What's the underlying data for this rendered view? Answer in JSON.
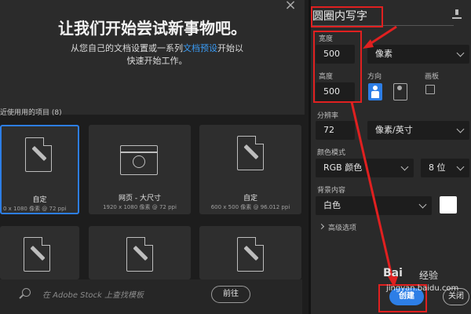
{
  "hero": {
    "title": "让我们开始尝试新事物吧。",
    "subtitle_pre": "从您自己的文档设置或一系列",
    "subtitle_link": "文档预设",
    "subtitle_post": "开始以",
    "subtitle_line2": "快速开始工作。"
  },
  "recent": {
    "label": "近使用用的项目 (8)",
    "cards": [
      {
        "name": "自定",
        "spec": "0 x 1080 像素 @ 72 ppi",
        "icon": "document-brush-icon"
      },
      {
        "name": "网页 - 大尺寸",
        "spec": "1920 x 1080 像素 @ 72 ppi",
        "icon": "browser-globe-icon"
      },
      {
        "name": "自定",
        "spec": "600 x 500 像素 @ 96.012 ppi",
        "icon": "document-brush-icon"
      }
    ]
  },
  "search": {
    "placeholder": "在 Adobe Stock 上查找模板",
    "button": "前往"
  },
  "preset": {
    "name": "圆圈内写字",
    "width_label": "宽度",
    "width": "500",
    "width_unit": "像素",
    "height_label": "高度",
    "height": "500",
    "orientation_label": "方向",
    "artboard_label": "画板",
    "resolution_label": "分辨率",
    "resolution": "72",
    "resolution_unit": "像素/英寸",
    "color_mode_label": "颜色模式",
    "color_mode": "RGB 颜色",
    "bit_depth": "8 位",
    "background_label": "背景内容",
    "background": "白色",
    "background_swatch": "#ffffff",
    "advanced": "高级选项"
  },
  "actions": {
    "create": "创建",
    "close": "关闭"
  },
  "watermark": {
    "brand": "Bai",
    "brand2": "经验",
    "url": "jingyan.baidu.com"
  },
  "colors": {
    "accent": "#2d7ee6",
    "annotation": "#e02020"
  }
}
